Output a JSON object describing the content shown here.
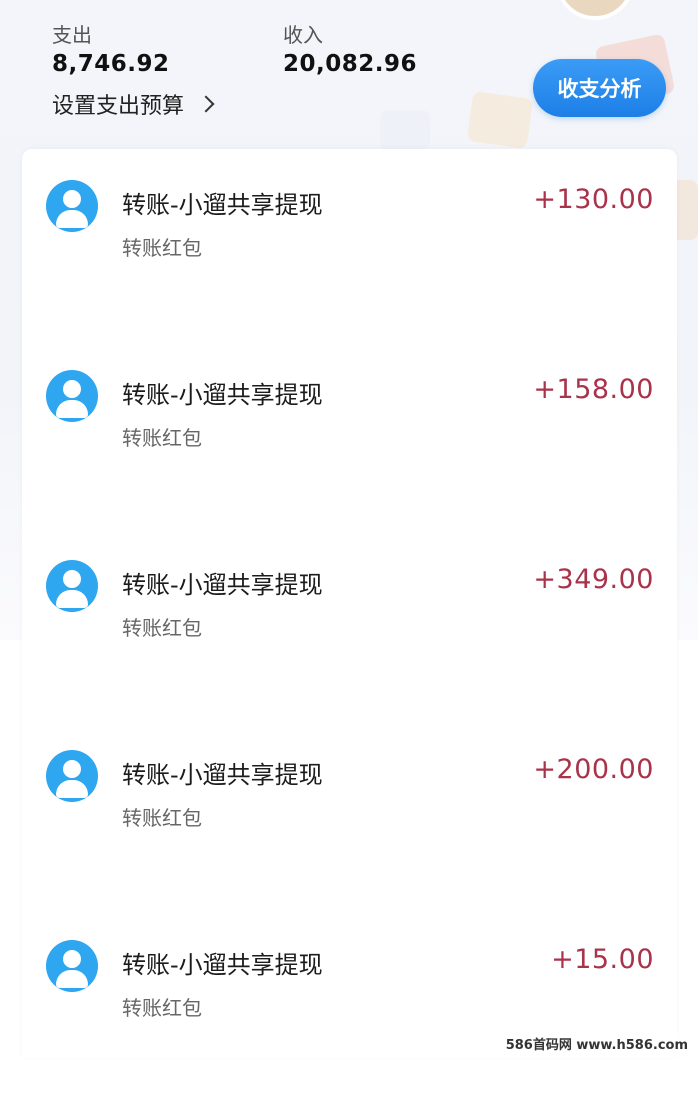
{
  "summary": {
    "expense_label": "支出",
    "expense_value": "8,746.92",
    "income_label": "收入",
    "income_value": "20,082.96",
    "budget_link": "设置支出预算",
    "analysis_button": "收支分析"
  },
  "transactions": [
    {
      "title": "转账-小遛共享提现",
      "subtitle": "转账红包",
      "amount": "+130.00"
    },
    {
      "title": "转账-小遛共享提现",
      "subtitle": "转账红包",
      "amount": "+158.00"
    },
    {
      "title": "转账-小遛共享提现",
      "subtitle": "转账红包",
      "amount": "+349.00"
    },
    {
      "title": "转账-小遛共享提现",
      "subtitle": "转账红包",
      "amount": "+200.00"
    },
    {
      "title": "转账-小遛共享提现",
      "subtitle": "转账红包",
      "amount": "+15.00"
    }
  ],
  "watermark": "586首码网 www.h586.com",
  "colors": {
    "accent": "#1d7fe6",
    "income_amount": "#a8334a",
    "avatar": "#2ea6f0"
  },
  "icons": {
    "transaction_avatar": "user-avatar-icon",
    "budget_link": "chevron-right-icon"
  }
}
